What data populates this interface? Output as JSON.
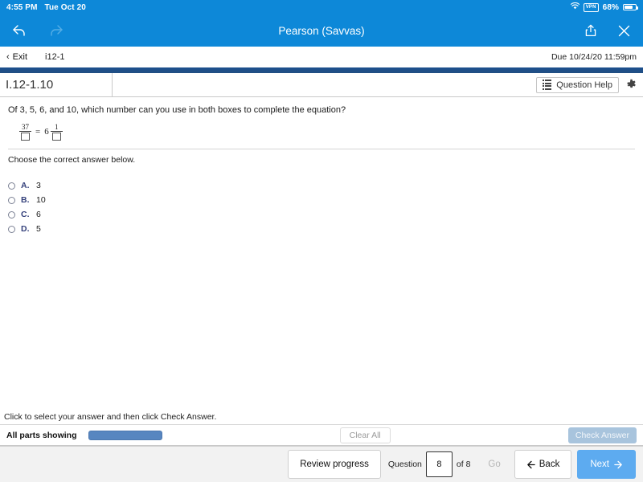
{
  "status_bar": {
    "time": "4:55 PM",
    "date": "Tue Oct 20",
    "wifi_icon": "wifi-icon",
    "vpn_label": "VPN",
    "battery_percent": "68%",
    "battery_icon": "battery-icon"
  },
  "app_bar": {
    "title": "Pearson (Savvas)",
    "back_icon": "back-arrow-icon",
    "forward_icon": "forward-arrow-icon",
    "share_icon": "share-icon",
    "close_icon": "close-icon",
    "background_color": "#0d88d8"
  },
  "exit_bar": {
    "exit_label": "Exit",
    "exit_chevron": "‹",
    "assignment_id": "i12-1",
    "due_text": "Due 10/24/20 11:59pm"
  },
  "question_bar": {
    "question_number": "I.12-1.10",
    "question_help_label": "Question Help",
    "question_help_icon": "list-icon",
    "settings_icon": "gear-icon"
  },
  "content": {
    "prompt": "Of 3, 5, 6, and 10, which number can you use in both boxes to complete the equation?",
    "equation": {
      "left_numerator": "37",
      "left_denominator_box": "",
      "equals": "=",
      "whole_number": "6",
      "right_numerator": "1",
      "right_denominator_box": ""
    },
    "choose_instruction": "Choose the correct answer below.",
    "choices": [
      {
        "letter": "A.",
        "text": "3",
        "selected": false
      },
      {
        "letter": "B.",
        "text": "10",
        "selected": false
      },
      {
        "letter": "C.",
        "text": "6",
        "selected": false
      },
      {
        "letter": "D.",
        "text": "5",
        "selected": false
      }
    ]
  },
  "hint": {
    "text": "Click to select your answer and then click Check Answer."
  },
  "parts_row": {
    "parts_label": "All parts showing",
    "progress_percent": 100,
    "clear_all_label": "Clear All",
    "check_answer_label": "Check Answer",
    "check_answer_color": "#a8c4dd"
  },
  "bottom_nav": {
    "review_progress_label": "Review progress",
    "question_label": "Question",
    "question_value": "8",
    "of_label": "of 8",
    "go_label": "Go",
    "back_label": "Back",
    "back_icon": "left-arrow-icon",
    "next_label": "Next",
    "next_icon": "right-arrow-icon",
    "next_color": "#5dabf0"
  }
}
